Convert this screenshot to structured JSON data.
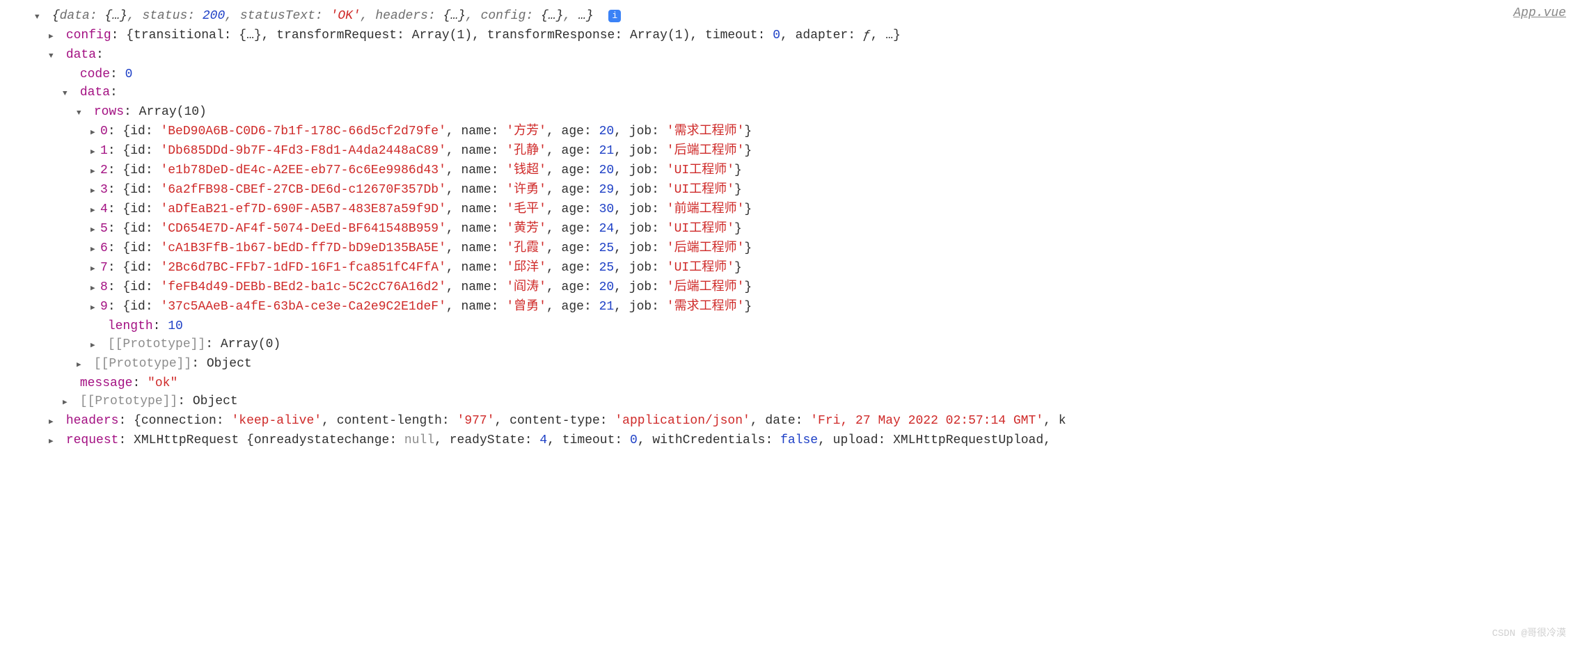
{
  "file_link": "App.vue",
  "summary": {
    "data": "{…}",
    "status": 200,
    "statusText": "'OK'",
    "headers": "{…}",
    "config": "{…}",
    "rest": "…"
  },
  "config_preview": "{transitional: {…}, transformRequest: Array(1), transformResponse: Array(1), timeout: 0, adapter: ƒ, …}",
  "data_section": {
    "code": 0,
    "rows_label": "Array(10)",
    "length": 10,
    "rows": [
      {
        "idx": "0",
        "id": "BeD90A6B-C0D6-7b1f-178C-66d5cf2d79fe",
        "name": "方芳",
        "age": 20,
        "job": "需求工程师"
      },
      {
        "idx": "1",
        "id": "Db685DDd-9b7F-4Fd3-F8d1-A4da2448aC89",
        "name": "孔静",
        "age": 21,
        "job": "后端工程师"
      },
      {
        "idx": "2",
        "id": "e1b78DeD-dE4c-A2EE-eb77-6c6Ee9986d43",
        "name": "钱超",
        "age": 20,
        "job": "UI工程师"
      },
      {
        "idx": "3",
        "id": "6a2fFB98-CBEf-27CB-DE6d-c12670F357Db",
        "name": "许勇",
        "age": 29,
        "job": "UI工程师"
      },
      {
        "idx": "4",
        "id": "aDfEaB21-ef7D-690F-A5B7-483E87a59f9D",
        "name": "毛平",
        "age": 30,
        "job": "前端工程师"
      },
      {
        "idx": "5",
        "id": "CD654E7D-AF4f-5074-DeEd-BF641548B959",
        "name": "黄芳",
        "age": 24,
        "job": "UI工程师"
      },
      {
        "idx": "6",
        "id": "cA1B3FfB-1b67-bEdD-ff7D-bD9eD135BA5E",
        "name": "孔霞",
        "age": 25,
        "job": "后端工程师"
      },
      {
        "idx": "7",
        "id": "2Bc6d7BC-FFb7-1dFD-16F1-fca851fC4FfA",
        "name": "邱洋",
        "age": 25,
        "job": "UI工程师"
      },
      {
        "idx": "8",
        "id": "feFB4d49-DEBb-BEd2-ba1c-5C2cC76A16d2",
        "name": "阎涛",
        "age": 20,
        "job": "后端工程师"
      },
      {
        "idx": "9",
        "id": "37c5AAeB-a4fE-63bA-ce3e-Ca2e9C2E1deF",
        "name": "曾勇",
        "age": 21,
        "job": "需求工程师"
      }
    ],
    "proto_rows": "Array(0)",
    "proto_data": "Object",
    "message": "\"ok\"",
    "proto_outer": "Object"
  },
  "headers_preview": {
    "connection": "'keep-alive'",
    "content_length": "'977'",
    "content_type": "'application/json'",
    "date": "'Fri, 27 May 2022 02:57:14 GMT'"
  },
  "request_preview": {
    "type": "XMLHttpRequest",
    "onreadystatechange": "null",
    "readyState": 4,
    "timeout": 0,
    "withCredentials": "false",
    "upload": "XMLHttpRequestUpload"
  },
  "watermark": "CSDN @哥很冷漠"
}
